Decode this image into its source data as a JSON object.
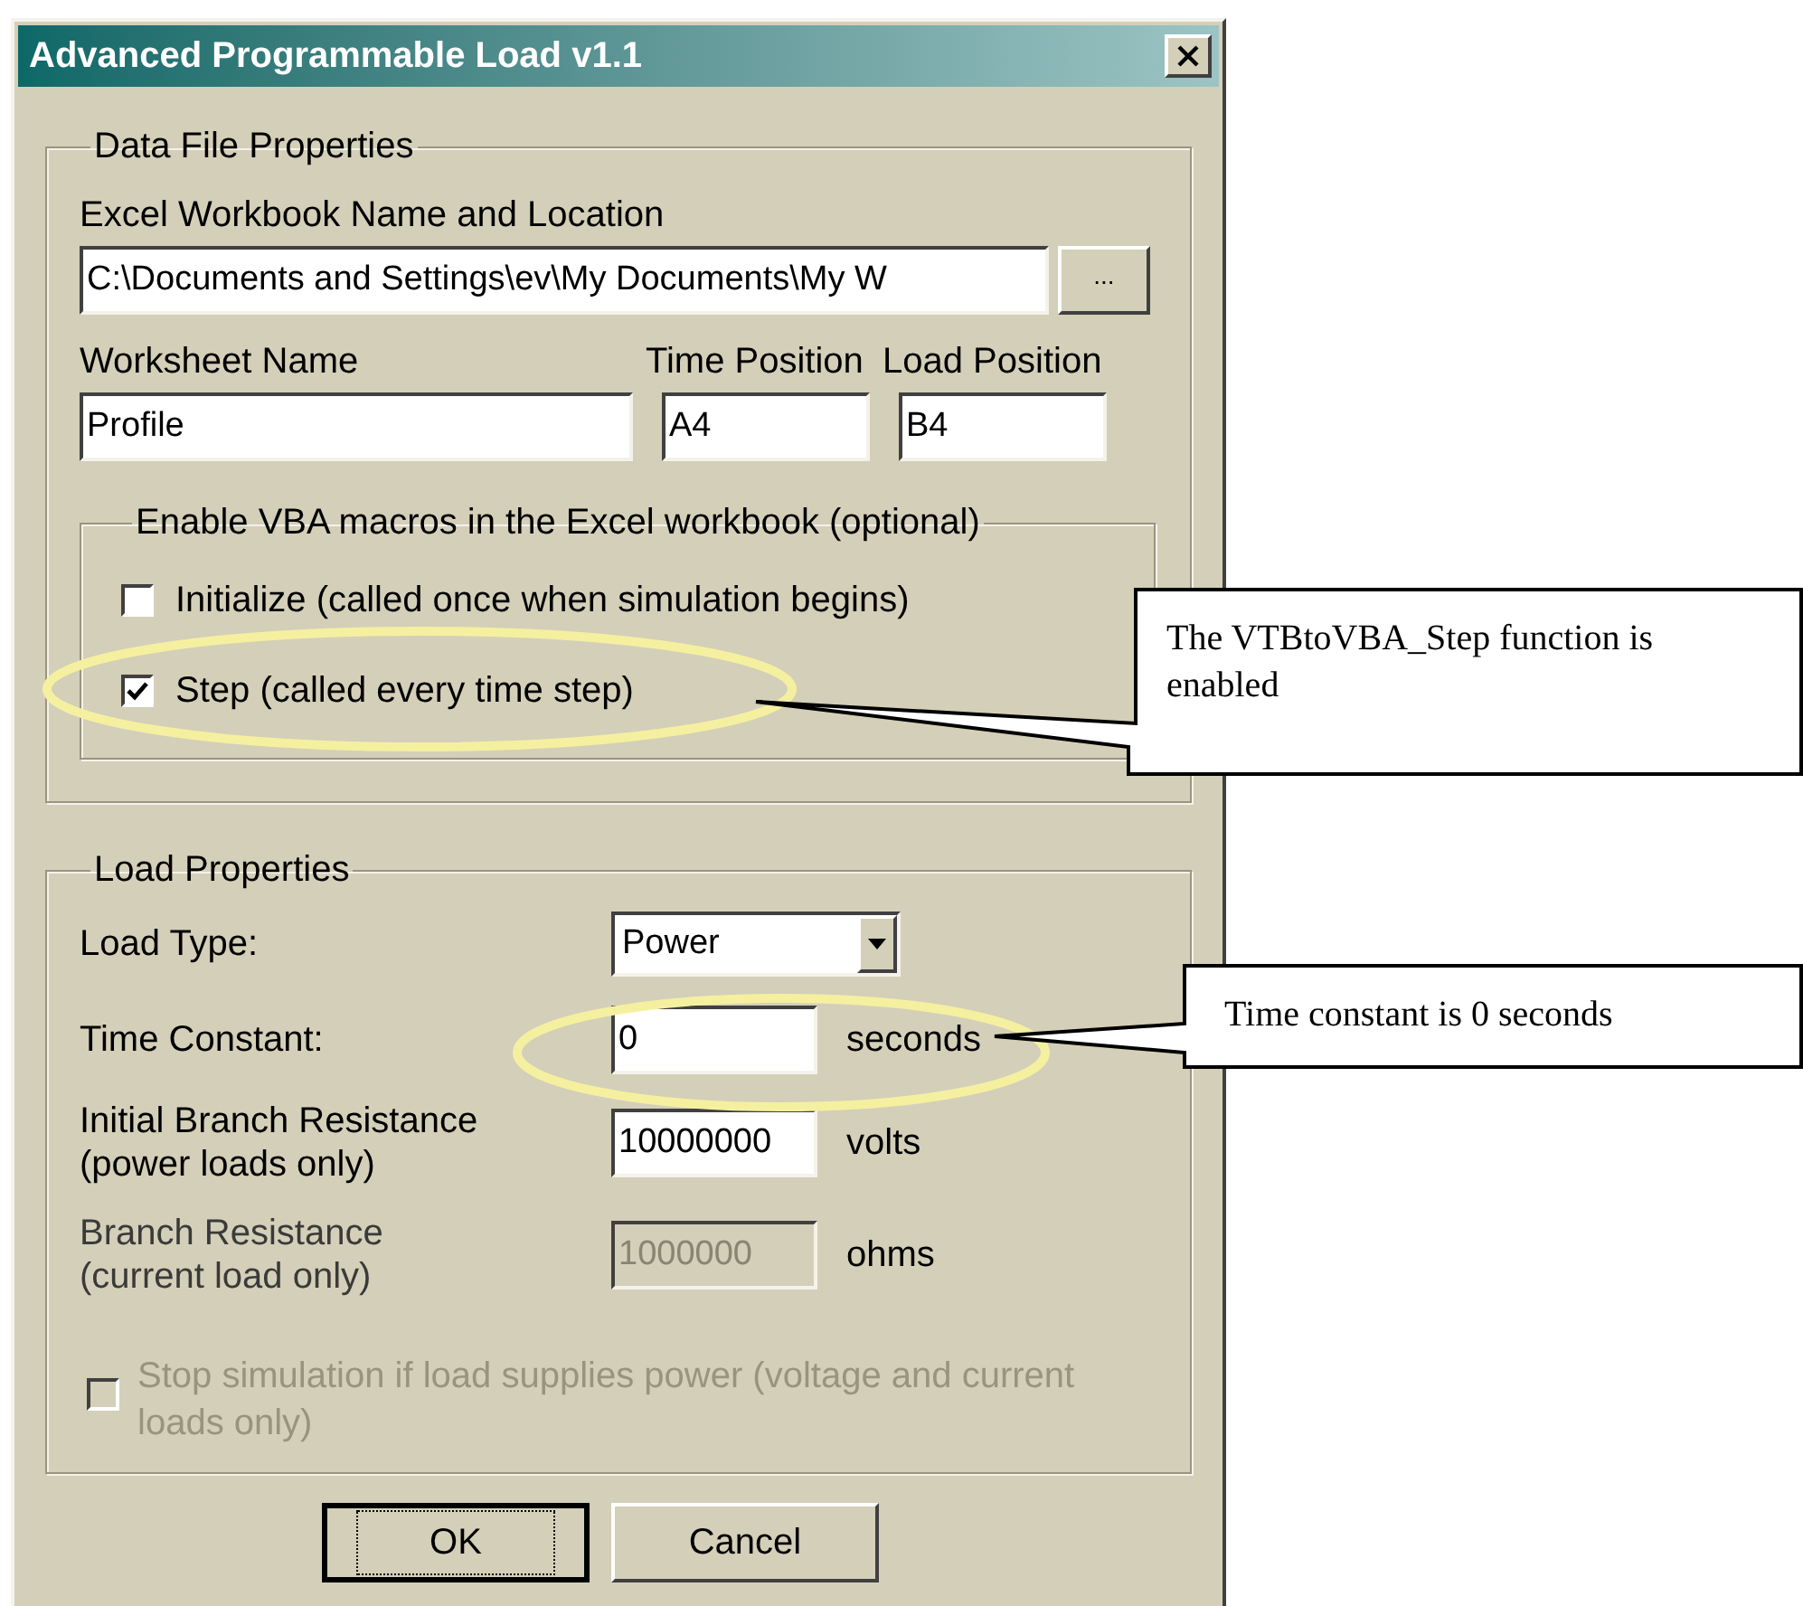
{
  "window": {
    "title": "Advanced Programmable Load v1.1"
  },
  "data_file": {
    "legend": "Data File Properties",
    "workbook": {
      "label": "Excel Workbook Name and Location",
      "value": "C:\\Documents and Settings\\ev\\My Documents\\My W",
      "browse_label": "..."
    },
    "worksheet": {
      "label": "Worksheet Name",
      "value": "Profile"
    },
    "time_position": {
      "label": "Time Position",
      "value": "A4"
    },
    "load_position": {
      "label": "Load Position",
      "value": "B4"
    },
    "macros": {
      "legend": "Enable VBA macros in the Excel workbook (optional)",
      "options": [
        {
          "label": "Initialize (called once when simulation begins)",
          "checked": false
        },
        {
          "label": "Step (called every time step)",
          "checked": true
        }
      ]
    }
  },
  "load": {
    "legend": "Load Properties",
    "load_type": {
      "label": "Load Type:",
      "value": "Power"
    },
    "fields": [
      {
        "label": "Time Constant:",
        "value": "0",
        "unit": "seconds",
        "disabled": false
      },
      {
        "label": "Initial Branch Resistance",
        "note": "(power loads only)",
        "value": "10000000",
        "unit": "volts",
        "disabled": false
      },
      {
        "label": "Branch Resistance",
        "note": "(current load only)",
        "value": "1000000",
        "unit": "ohms",
        "disabled": true
      }
    ],
    "stop": {
      "label": "Stop simulation if load supplies power (voltage and current loads only)",
      "checked": false,
      "disabled": true
    }
  },
  "buttons": [
    {
      "label": "OK",
      "default": true
    },
    {
      "label": "Cancel",
      "default": false
    }
  ],
  "callouts": [
    {
      "text": "The VTBtoVBA_Step function is enabled"
    },
    {
      "text": "Time constant is 0 seconds"
    }
  ]
}
